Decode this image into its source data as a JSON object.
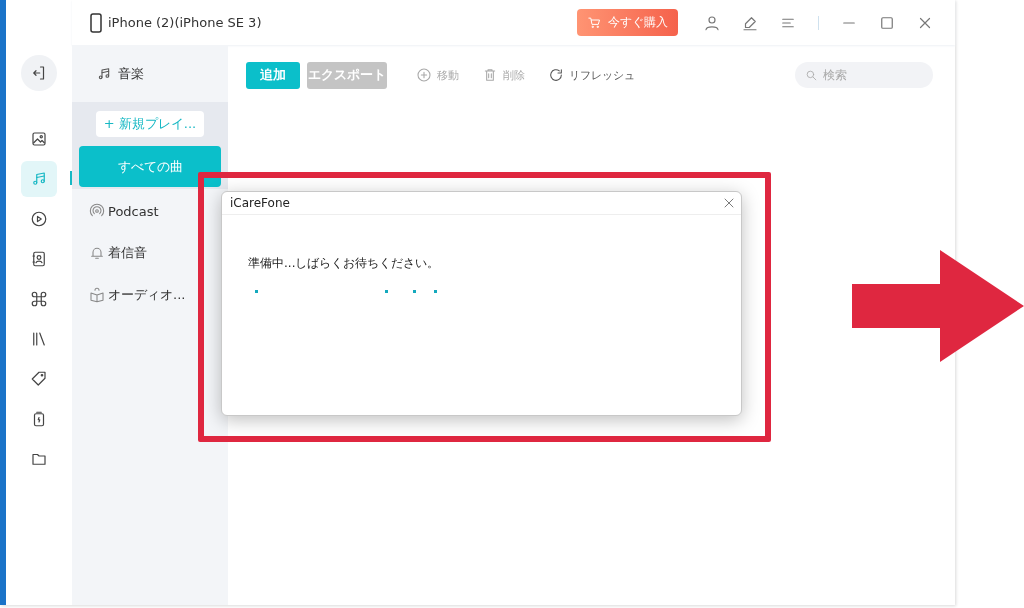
{
  "window": {
    "device": "iPhone (2)(iPhone SE 3)",
    "buy_button": "今すぐ購入"
  },
  "nav_rail": [
    {
      "selected": false
    },
    {
      "selected": false
    },
    {
      "selected": true
    },
    {
      "selected": false
    },
    {
      "selected": false
    },
    {
      "selected": false
    },
    {
      "selected": false
    },
    {
      "selected": false
    },
    {
      "selected": false
    },
    {
      "selected": false
    }
  ],
  "sidebar": {
    "header": "音楽",
    "new_playlist": "+ 新規プレイ...",
    "items": [
      {
        "label": "すべての曲",
        "selected": true
      },
      {
        "label": "Podcast",
        "selected": false
      },
      {
        "label": "着信音",
        "selected": false
      },
      {
        "label": "オーディオ...",
        "selected": false
      }
    ]
  },
  "toolbar": {
    "buttons": [
      {
        "label": "追加",
        "disabled": false
      },
      {
        "label": "エクスポート",
        "disabled": true
      }
    ],
    "actions": [
      {
        "label": "移動",
        "disabled": true
      },
      {
        "label": "削除",
        "disabled": true
      },
      {
        "label": "リフレッシュ",
        "disabled": false
      }
    ],
    "search": {
      "placeholder": "検索"
    }
  },
  "dialog": {
    "title": "iCareFone",
    "message": "準備中...しばらくお待ちください。"
  }
}
